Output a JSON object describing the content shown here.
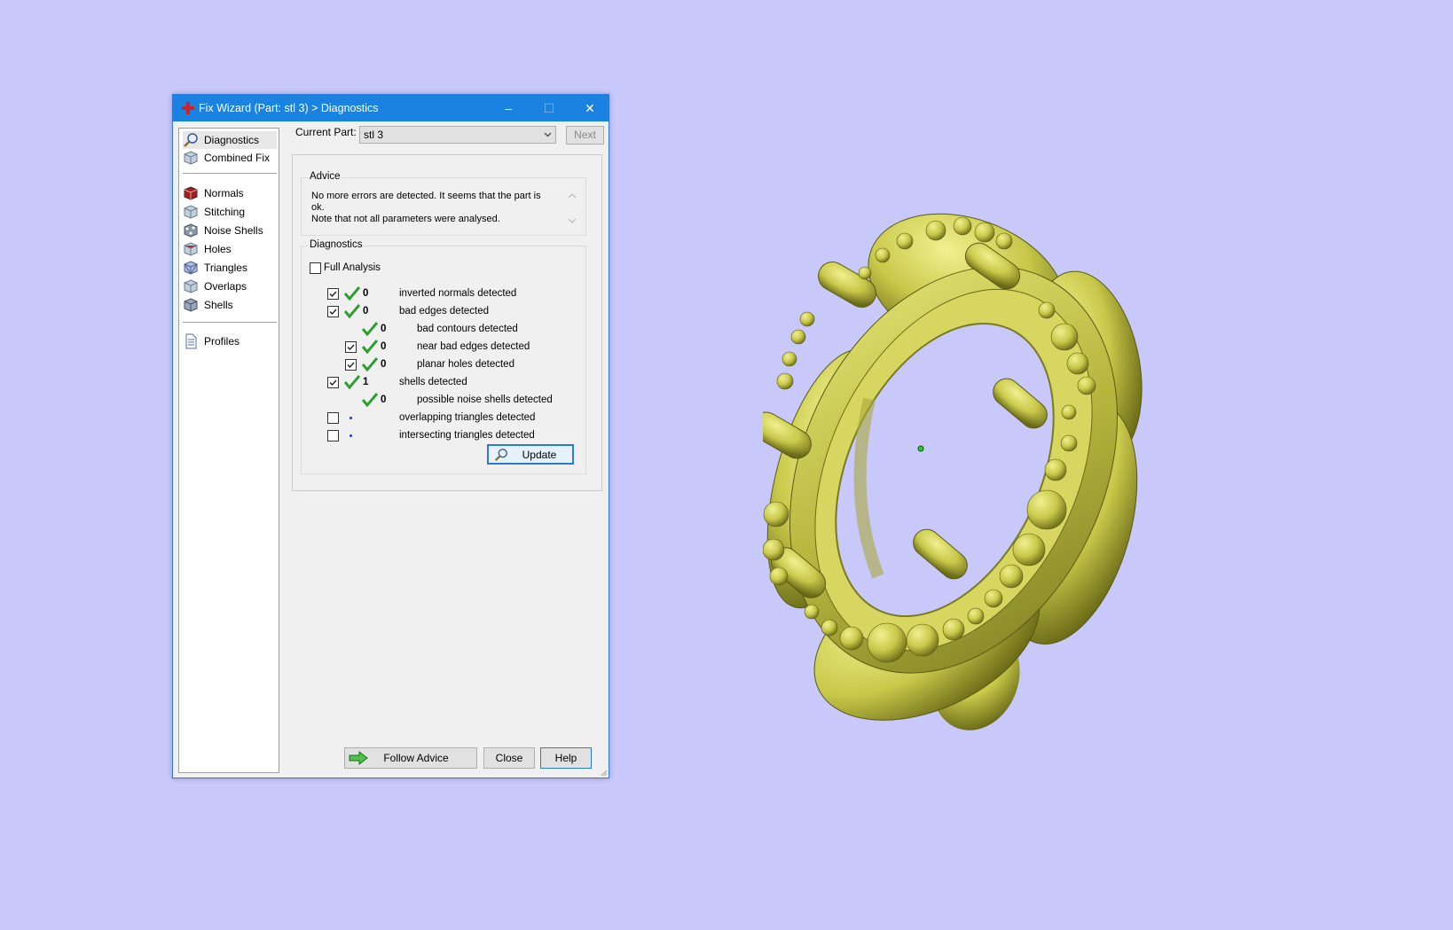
{
  "window": {
    "title": "Fix Wizard (Part: stl 3) > Diagnostics",
    "controls": {
      "minimize": "–",
      "maximize": "☐",
      "close": "✕"
    }
  },
  "nav": {
    "top_items": [
      {
        "label": "Diagnostics",
        "icon": "magnifier-icon",
        "selected": true
      },
      {
        "label": "Combined Fix",
        "icon": "cube-icon"
      }
    ],
    "fix_items": [
      {
        "label": "Normals",
        "icon": "normals-cube-icon"
      },
      {
        "label": "Stitching",
        "icon": "stitching-cube-icon"
      },
      {
        "label": "Noise Shells",
        "icon": "noise-shells-icon"
      },
      {
        "label": "Holes",
        "icon": "holes-cube-icon"
      },
      {
        "label": "Triangles",
        "icon": "triangles-cube-icon"
      },
      {
        "label": "Overlaps",
        "icon": "overlaps-cube-icon"
      },
      {
        "label": "Shells",
        "icon": "shells-cube-icon"
      }
    ],
    "bottom_items": [
      {
        "label": "Profiles",
        "icon": "document-icon"
      }
    ]
  },
  "current_part": {
    "label": "Current Part:",
    "value": "stl 3",
    "next_label": "Next"
  },
  "advice": {
    "title": "Advice",
    "line1": "No more errors are detected. It seems that the part is ok.",
    "line2": "Note that not all parameters were analysed."
  },
  "diagnostics": {
    "title": "Diagnostics",
    "full_analysis_label": "Full Analysis",
    "full_analysis_checked": false,
    "rows": [
      {
        "checkbox": true,
        "status": "ok",
        "count": "0",
        "label": "inverted normals detected",
        "indent": 0
      },
      {
        "checkbox": true,
        "status": "ok",
        "count": "0",
        "label": "bad edges detected",
        "indent": 0
      },
      {
        "checkbox": null,
        "status": "ok",
        "count": "0",
        "label": "bad contours detected",
        "indent": 1
      },
      {
        "checkbox": true,
        "status": "ok",
        "count": "0",
        "label": "near bad edges detected",
        "indent": 1
      },
      {
        "checkbox": true,
        "status": "ok",
        "count": "0",
        "label": "planar holes detected",
        "indent": 1
      },
      {
        "checkbox": true,
        "status": "ok",
        "count": "1",
        "label": "shells detected",
        "indent": 0
      },
      {
        "checkbox": null,
        "status": "ok",
        "count": "0",
        "label": "possible noise shells detected",
        "indent": 1
      },
      {
        "checkbox": false,
        "status": "none",
        "count": "",
        "label": "overlapping triangles detected",
        "indent": 0
      },
      {
        "checkbox": false,
        "status": "none",
        "count": "",
        "label": "intersecting triangles detected",
        "indent": 0
      }
    ],
    "update_label": "Update"
  },
  "footer": {
    "follow_advice_label": "Follow Advice",
    "close_label": "Close",
    "help_label": "Help"
  },
  "colors": {
    "desktop": "#c8c8fa",
    "titlebar": "#1a82e0",
    "check_green": "#2e9e2e",
    "model_gold": "#c8c850"
  }
}
